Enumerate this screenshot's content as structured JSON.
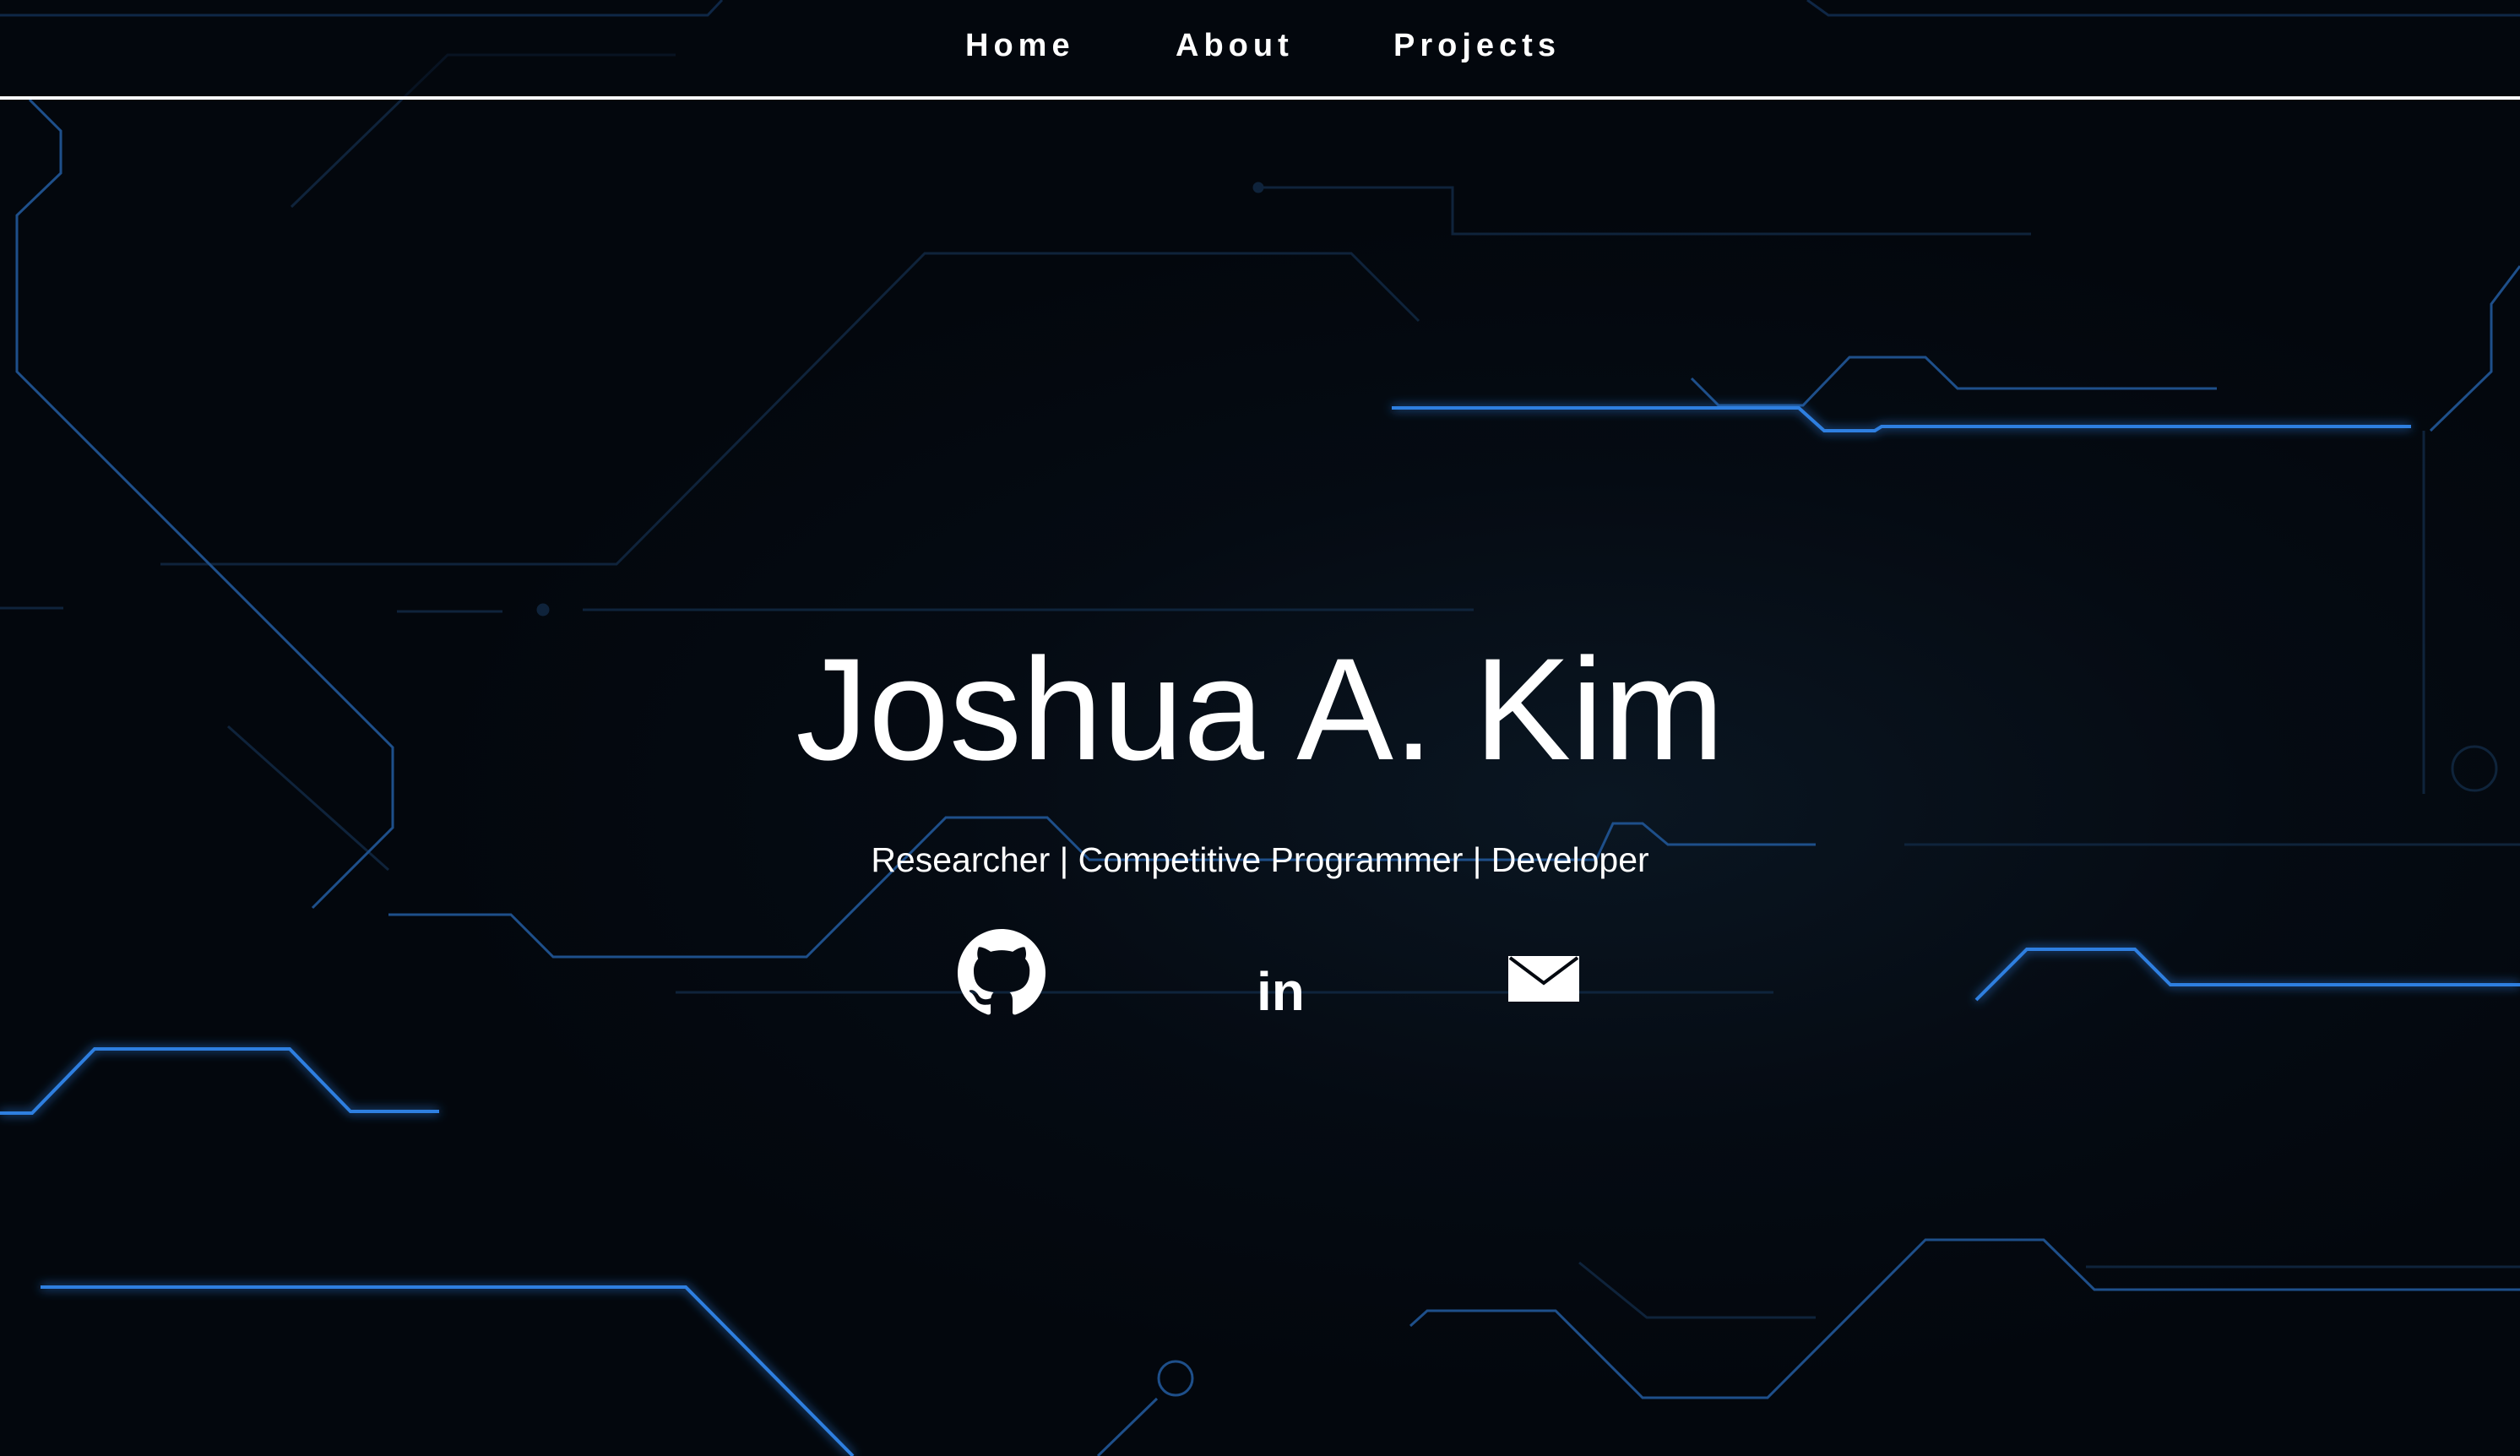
{
  "nav": {
    "items": [
      {
        "label": "Home"
      },
      {
        "label": "About"
      },
      {
        "label": "Projects"
      }
    ]
  },
  "hero": {
    "name": "Joshua A. Kim",
    "subtitle": "Researcher | Competitive Programmer | Developer"
  },
  "social": {
    "icons": [
      "github-icon",
      "linkedin-icon",
      "email-icon"
    ],
    "linkedin_text": "in"
  },
  "colors": {
    "background": "#03080f",
    "circuit_glow": "#2f7fe0",
    "circuit_dim": "#14304e",
    "text": "#ffffff"
  }
}
